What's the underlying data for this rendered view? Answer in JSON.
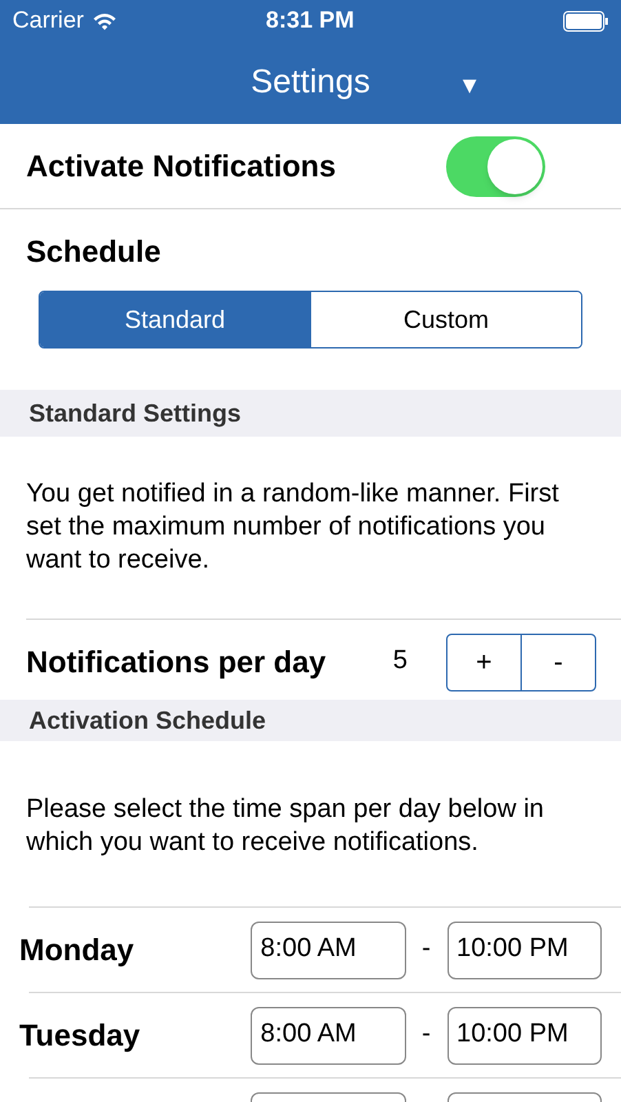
{
  "status_bar": {
    "carrier": "Carrier",
    "time": "8:31 PM"
  },
  "nav": {
    "title": "Settings",
    "menu_glyph": "▾"
  },
  "activate": {
    "label": "Activate Notifications",
    "on": true
  },
  "schedule": {
    "label": "Schedule",
    "segments": [
      {
        "label": "Standard",
        "selected": true
      },
      {
        "label": "Custom",
        "selected": false
      }
    ]
  },
  "standard_settings": {
    "header": "Standard Settings",
    "description": "You get notified in a random-like manner. First set the maximum number of notifications you want to receive.",
    "per_day_label": "Notifications per day",
    "per_day_value": "5",
    "plus": "+",
    "minus": "-"
  },
  "activation_schedule": {
    "header": "Activation Schedule",
    "description": "Please select the time span per day below in which you want to receive notifications.",
    "days": [
      {
        "day": "Monday",
        "start": "8:00 AM",
        "separator": "-",
        "end": "10:00 PM"
      },
      {
        "day": "Tuesday",
        "start": "8:00 AM",
        "separator": "-",
        "end": "10:00 PM"
      }
    ]
  }
}
